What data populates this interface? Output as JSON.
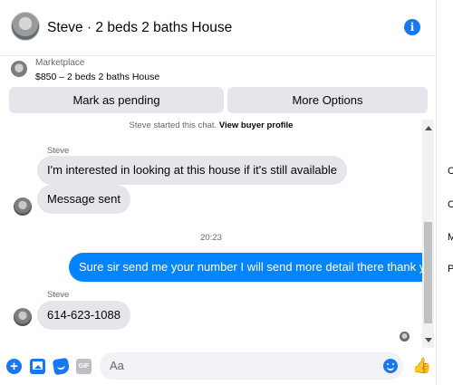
{
  "header": {
    "title": "Steve · 2 beds 2 baths House",
    "info_glyph": "i"
  },
  "marketplace": {
    "label": "Marketplace",
    "listing": "$850 – 2 beds 2 baths House",
    "pending_button": "Mark as pending",
    "options_button": "More Options"
  },
  "messages": {
    "system_prefix": "Steve started this chat.",
    "system_link": "View buyer profile",
    "sender_name_1": "Steve",
    "msg_1": "I'm interested in looking at this house if it's still available",
    "msg_2": "Message sent",
    "timestamp": "20:23",
    "msg_3": "Sure sir send me your number I will send more detail there thank you",
    "sender_name_2": "Steve",
    "msg_4": "614-623-1088"
  },
  "composer": {
    "placeholder": "Aa",
    "plus_glyph": "+",
    "gif_label": "GIF",
    "like_glyph": "👍"
  },
  "sidebar_letters": [
    "C",
    "C",
    "M",
    "P"
  ],
  "colors": {
    "accent": "#1877f2",
    "outgoing_bubble": "#0084ff",
    "incoming_bubble": "#e4e6eb"
  },
  "icons": [
    "info-icon",
    "plus-icon",
    "photo-icon",
    "sticker-icon",
    "gif-icon",
    "emoji-icon",
    "thumbs-up-icon"
  ]
}
